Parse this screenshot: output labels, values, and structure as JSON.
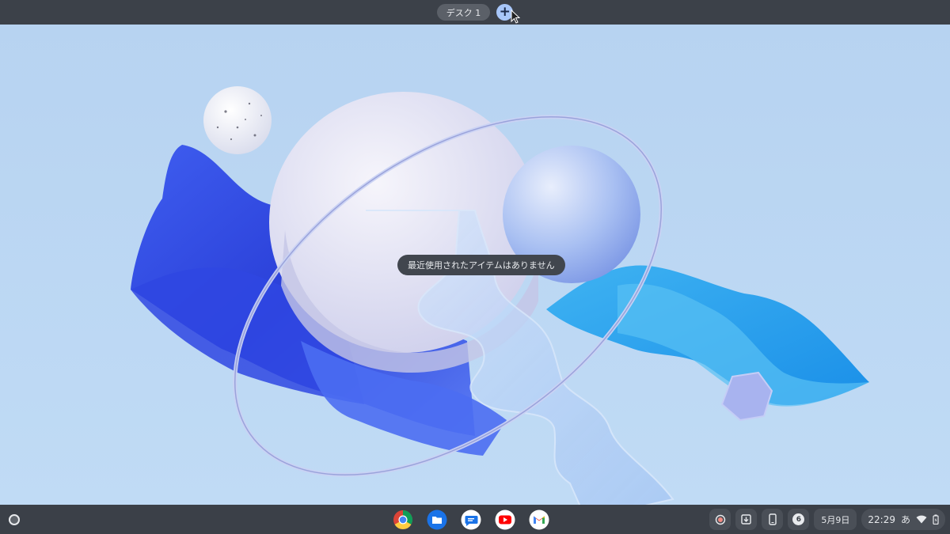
{
  "desk_bar": {
    "desk_label": "デスク 1",
    "add_desk_symbol": "+"
  },
  "toast": {
    "message": "最近使用されたアイテムはありません"
  },
  "shelf": {
    "launcher_icon": "launcher-circle-icon",
    "pinned_apps": [
      {
        "name": "Chrome",
        "icon": "chrome-icon"
      },
      {
        "name": "Files",
        "icon": "files-icon"
      },
      {
        "name": "Messages",
        "icon": "messages-icon"
      },
      {
        "name": "YouTube",
        "icon": "youtube-icon"
      },
      {
        "name": "Gmail",
        "icon": "gmail-icon"
      }
    ],
    "tray": {
      "screen_record_icon": "screen-record-icon",
      "clipboard_icon": "holding-space-icon",
      "phone_icon": "phone-hub-icon",
      "notification_count": "6",
      "date": "5月9日",
      "time": "22:29",
      "ime": "あ",
      "wifi_icon": "wifi-icon",
      "battery_icon": "battery-icon"
    }
  },
  "colors": {
    "shelf_bg": "#3b4048",
    "accent_blue": "#a8c7fa",
    "wallpaper_bg": "#b9d6f2"
  }
}
